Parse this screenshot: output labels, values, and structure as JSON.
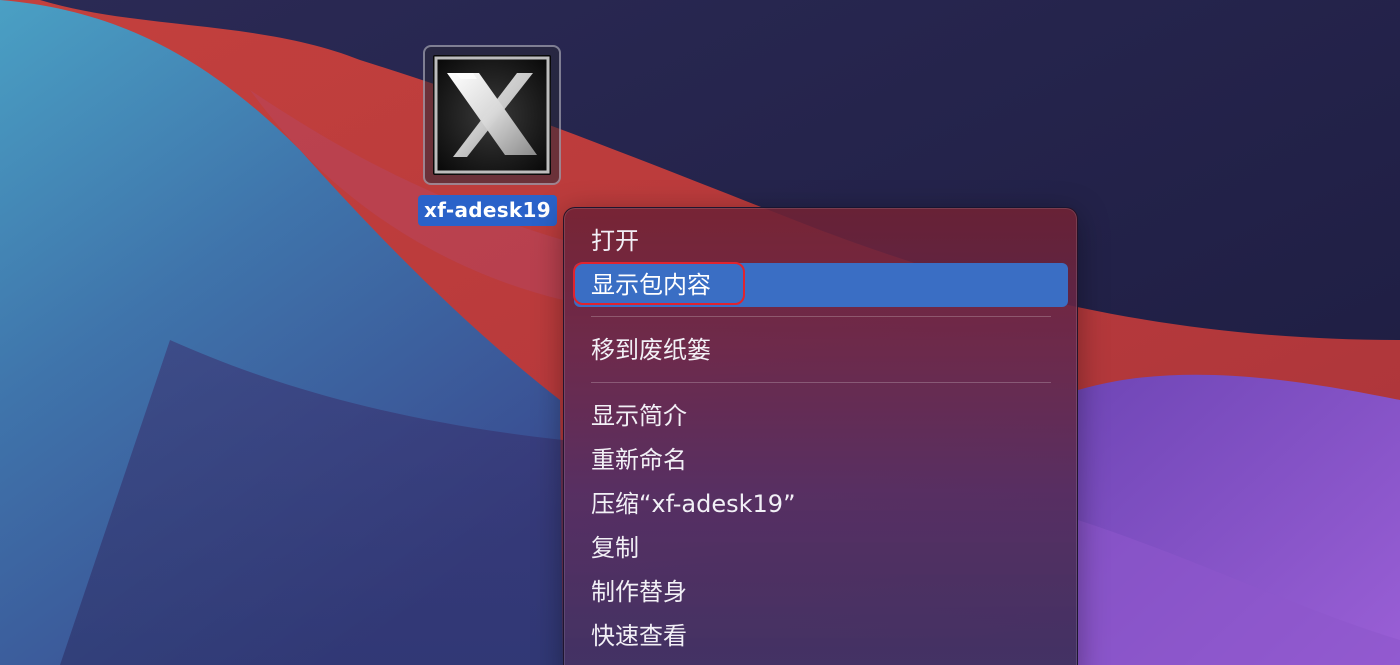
{
  "desktop": {
    "file_icon": {
      "name": "xf-adesk19",
      "glyph": "X",
      "icon": "x-app-icon"
    }
  },
  "context_menu": {
    "items": [
      {
        "label": "打开",
        "selected": false
      },
      {
        "label": "显示包内容",
        "selected": true
      },
      {
        "label": "移到废纸篓",
        "selected": false
      },
      {
        "label": "显示简介",
        "selected": false
      },
      {
        "label": "重新命名",
        "selected": false
      },
      {
        "label": "压缩“xf-adesk19”",
        "selected": false
      },
      {
        "label": "复制",
        "selected": false
      },
      {
        "label": "制作替身",
        "selected": false
      },
      {
        "label": "快速查看",
        "selected": false
      }
    ]
  },
  "colors": {
    "selection_blue": "#2a62c9",
    "menu_highlight": "#3a6ec4",
    "annotation_red": "#e0242e"
  }
}
